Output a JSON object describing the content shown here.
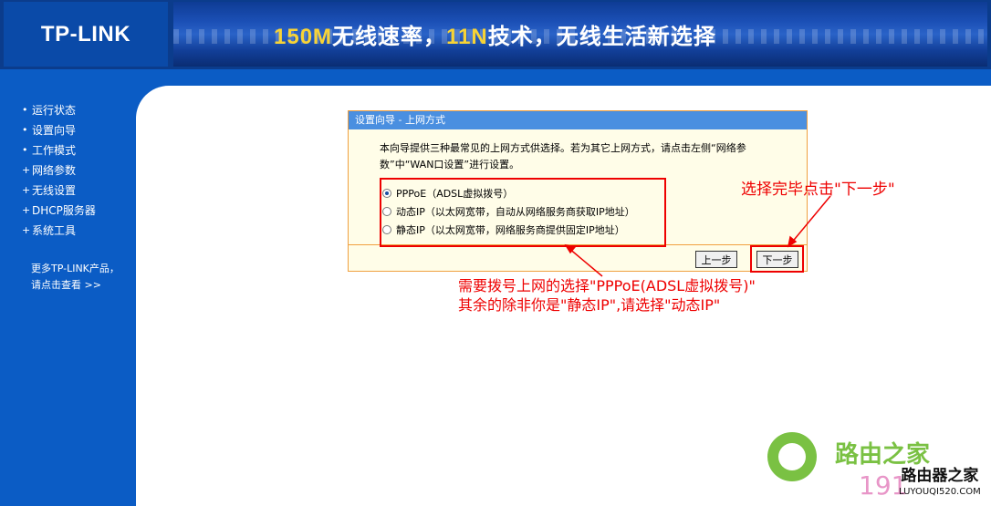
{
  "header": {
    "logo": "TP-LINK",
    "banner_part1": "150M",
    "banner_part2": "无线速率，",
    "banner_part3": "11N",
    "banner_part4": "技术，无线生活新选择"
  },
  "sidebar": {
    "items": [
      {
        "label": "运行状态",
        "bullet": "•"
      },
      {
        "label": "设置向导",
        "bullet": "•"
      },
      {
        "label": "工作模式",
        "bullet": "•"
      },
      {
        "label": "网络参数",
        "bullet": "+"
      },
      {
        "label": "无线设置",
        "bullet": "+"
      },
      {
        "label": "DHCP服务器",
        "bullet": "+"
      },
      {
        "label": "系统工具",
        "bullet": "+"
      }
    ],
    "more_line1": "更多TP-LINK产品，",
    "more_line2": "请点击查看 >>"
  },
  "wizard": {
    "title": "设置向导 - 上网方式",
    "description": "本向导提供三种最常见的上网方式供选择。若为其它上网方式，请点击左侧“网络参数”中“WAN口设置”进行设置。",
    "options": [
      {
        "label": "PPPoE（ADSL虚拟拨号）",
        "checked": true
      },
      {
        "label": "动态IP（以太网宽带，自动从网络服务商获取IP地址）",
        "checked": false
      },
      {
        "label": "静态IP（以太网宽带，网络服务商提供固定IP地址）",
        "checked": false
      }
    ],
    "prev_button": "上一步",
    "next_button": "下一步"
  },
  "annotations": {
    "next_hint": "选择完毕点击\"下一步\"",
    "line1": "需要拨号上网的选择\"PPPoE(ADSL虚拟拨号)\"",
    "line2": "其余的除非你是\"静态IP\",请选择\"动态IP\""
  },
  "watermark": {
    "brand": "路由之家",
    "number": "191",
    "small_title": "路由器之家",
    "small_url": "LUYOUQI520.COM"
  },
  "colors": {
    "header_bg": "#0b3c8c",
    "sidebar_bg": "#0b5cc5",
    "panel_title_bg": "#4a8fe0",
    "annotation_red": "#e00000",
    "watermark_green": "#7ac143"
  }
}
